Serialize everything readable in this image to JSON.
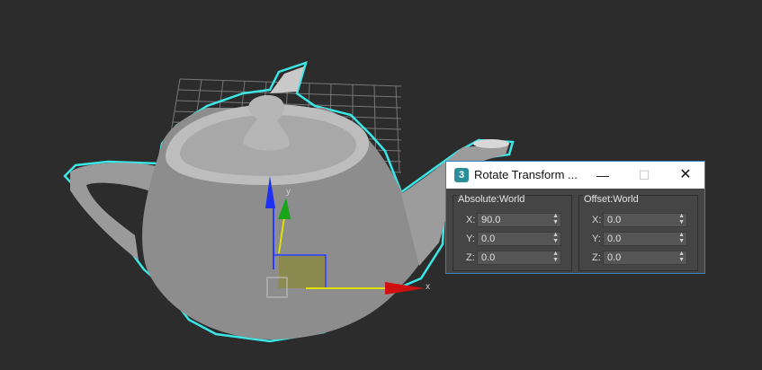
{
  "viewport": {
    "gizmo": {
      "x_label": "x",
      "y_label": "y"
    },
    "colors": {
      "background": "#2c2c2c",
      "selection_outline": "#3de6e6",
      "teapot": "#8f8f8f"
    }
  },
  "dialog": {
    "title": "Rotate Transform ...",
    "minimize_glyph": "—",
    "maximize_glyph": "☐",
    "close_glyph": "✕",
    "absolute_group": {
      "label": "Absolute:World",
      "rows": [
        {
          "axis": "X:",
          "value": "90.0"
        },
        {
          "axis": "Y:",
          "value": "0.0"
        },
        {
          "axis": "Z:",
          "value": "0.0"
        }
      ]
    },
    "offset_group": {
      "label": "Offset:World",
      "rows": [
        {
          "axis": "X:",
          "value": "0.0"
        },
        {
          "axis": "Y:",
          "value": "0.0"
        },
        {
          "axis": "Z:",
          "value": "0.0"
        }
      ]
    }
  }
}
